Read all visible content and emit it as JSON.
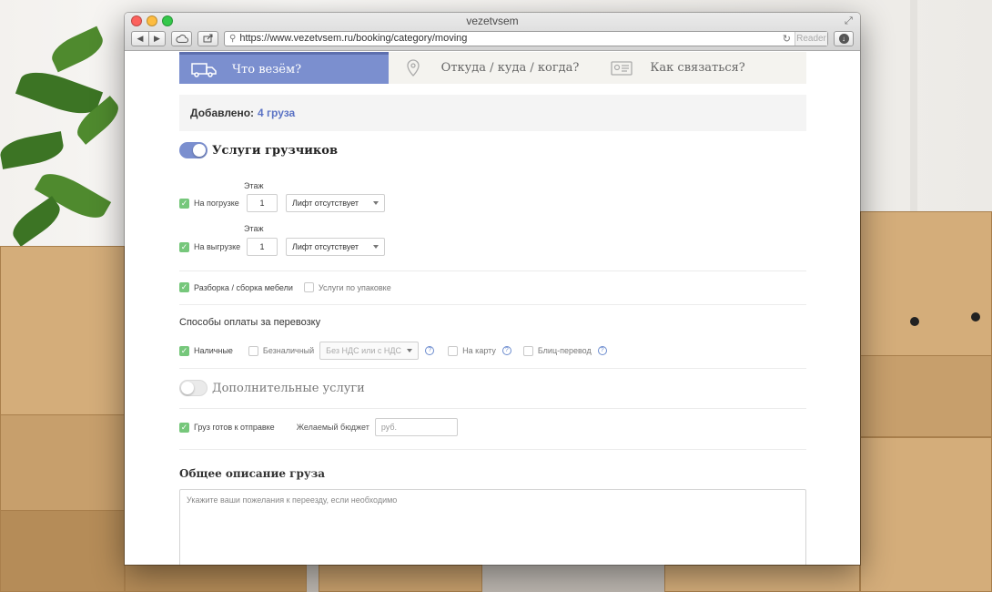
{
  "window": {
    "title": "vezetvsem",
    "url": "https://www.vezetvsem.ru/booking/category/moving",
    "reader_label": "Reader"
  },
  "steps": [
    {
      "label": "Что везём?",
      "icon": "truck-icon",
      "active": true
    },
    {
      "label": "Откуда / куда / когда?",
      "icon": "map-pin-icon",
      "active": false
    },
    {
      "label": "Как связаться?",
      "icon": "contact-card-icon",
      "active": false
    }
  ],
  "added": {
    "label": "Добавлено:",
    "count": "4 груза"
  },
  "movers": {
    "toggle_label": "Услуги грузчиков",
    "enabled": true,
    "floor_label": "Этаж",
    "loading": {
      "checkbox_label": "На погрузке",
      "checked": true,
      "floor": "1",
      "elevator": "Лифт отсутствует"
    },
    "unloading": {
      "checkbox_label": "На выгрузке",
      "checked": true,
      "floor": "1",
      "elevator": "Лифт отсутствует"
    },
    "furniture": {
      "label": "Разборка / сборка мебели",
      "checked": true
    },
    "packing": {
      "label": "Услуги по упаковке",
      "checked": false
    }
  },
  "payment": {
    "title": "Способы оплаты за перевозку",
    "cash": {
      "label": "Наличные",
      "checked": true
    },
    "cashless": {
      "label": "Безналичный",
      "checked": false,
      "vat_select": "Без НДС или с НДС"
    },
    "card": {
      "label": "На карту",
      "checked": false
    },
    "blitz": {
      "label": "Блиц-перевод",
      "checked": false
    },
    "help_glyph": "?"
  },
  "extra": {
    "toggle_label": "Дополнительные услуги",
    "enabled": false
  },
  "cargo_ready": {
    "label": "Груз готов к отправке",
    "checked": true,
    "budget_label": "Желаемый бюджет",
    "budget_placeholder": "руб."
  },
  "description": {
    "title": "Общее описание груза",
    "placeholder": "Укажите ваши пожелания к переезду, если необходимо"
  },
  "colors": {
    "accent": "#7b8fcf",
    "check": "#76c77b",
    "link": "#5a72c4"
  }
}
